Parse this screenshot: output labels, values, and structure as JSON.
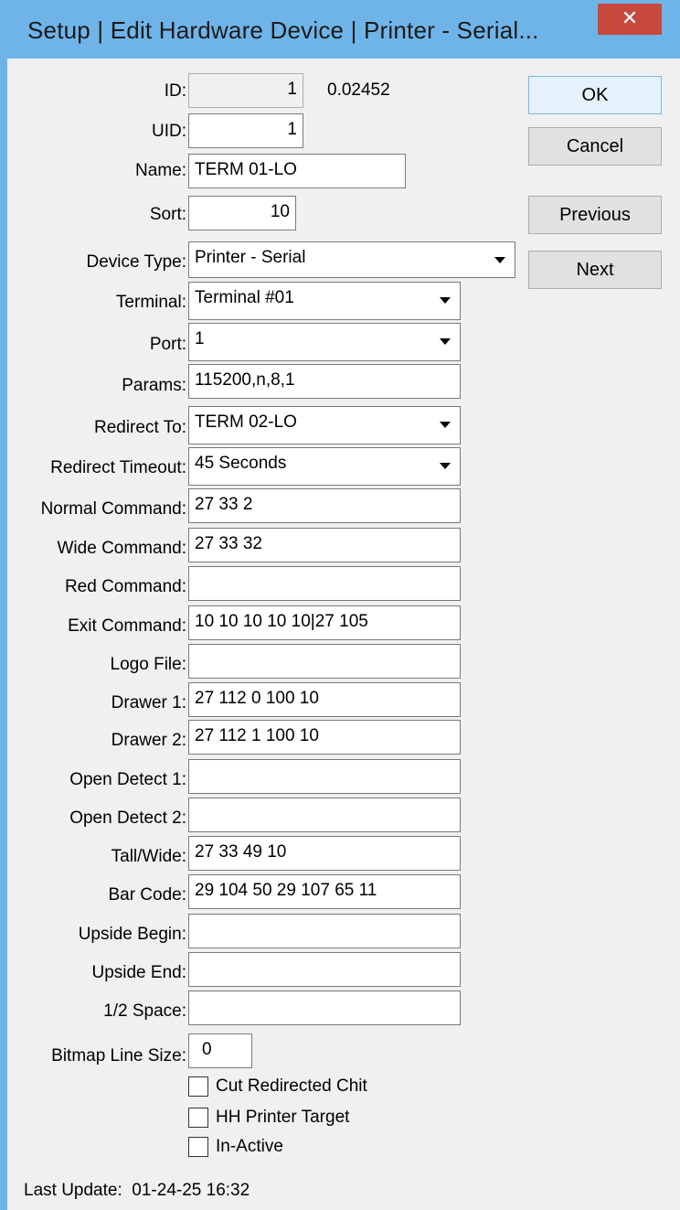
{
  "window": {
    "title": "Setup | Edit Hardware Device | Printer - Serial...",
    "close_glyph": "✕"
  },
  "header_fields": {
    "id_label": "ID:",
    "id_value": "1",
    "id_extra": "0.02452",
    "uid_label": "UID:",
    "uid_value": "1",
    "name_label": "Name:",
    "name_value": "TERM 01-LO",
    "sort_label": "Sort:",
    "sort_value": "10"
  },
  "buttons": {
    "ok": "OK",
    "cancel": "Cancel",
    "previous": "Previous",
    "next": "Next"
  },
  "dropdowns": {
    "device_type_label": "Device Type:",
    "device_type_value": "Printer - Serial",
    "terminal_label": "Terminal:",
    "terminal_value": "Terminal #01",
    "port_label": "Port:",
    "port_value": "1",
    "redirect_to_label": "Redirect To:",
    "redirect_to_value": "TERM 02-LO",
    "redirect_timeout_label": "Redirect Timeout:",
    "redirect_timeout_value": "45 Seconds"
  },
  "fields": {
    "params_label": "Params:",
    "params_value": "115200,n,8,1",
    "normal_label": "Normal Command:",
    "normal_value": "27 33 2",
    "wide_label": "Wide Command:",
    "wide_value": "27 33 32",
    "red_label": "Red Command:",
    "red_value": "",
    "exit_label": "Exit Command:",
    "exit_value": "10 10 10 10 10|27 105",
    "logo_label": "Logo File:",
    "logo_value": "",
    "drawer1_label": "Drawer 1:",
    "drawer1_value": "27 112 0 100 10",
    "drawer2_label": "Drawer 2:",
    "drawer2_value": "27 112 1 100 10",
    "open1_label": "Open Detect 1:",
    "open1_value": "",
    "open2_label": "Open Detect 2:",
    "open2_value": "",
    "tallwide_label": "Tall/Wide:",
    "tallwide_value": "27 33 49 10",
    "barcode_label": "Bar Code:",
    "barcode_value": "29 104 50 29 107 65 11",
    "upbegin_label": "Upside Begin:",
    "upbegin_value": "",
    "upend_label": "Upside End:",
    "upend_value": "",
    "halfspace_label": "1/2 Space:",
    "halfspace_value": "",
    "bitmap_label": "Bitmap Line Size:",
    "bitmap_value": "0"
  },
  "checkboxes": {
    "cut_label": "Cut Redirected Chit",
    "hh_label": "HH Printer Target",
    "inactive_label": "In-Active"
  },
  "footer": {
    "last_update": "Last Update:  01-24-25 16:32"
  }
}
